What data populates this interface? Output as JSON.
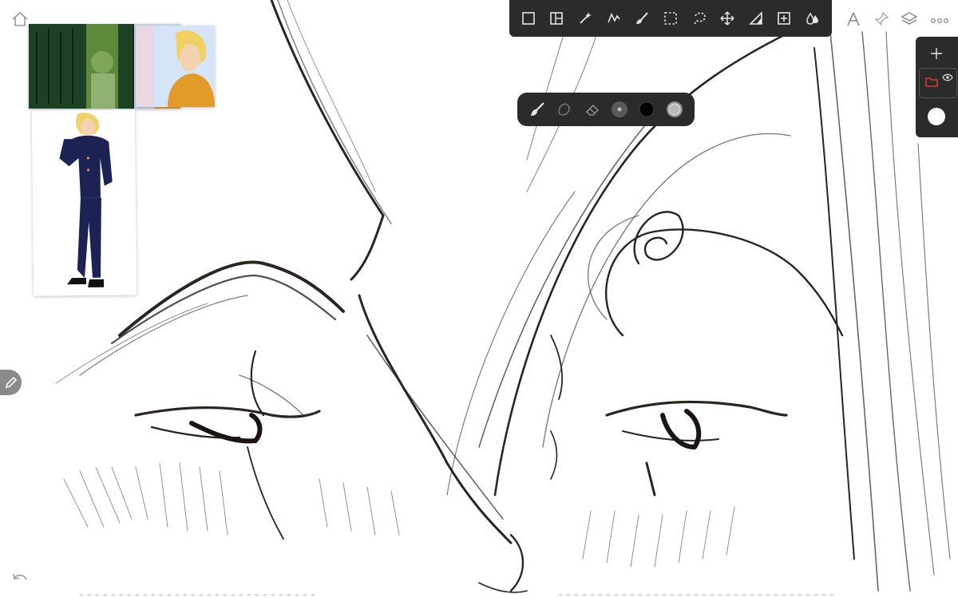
{
  "app": {
    "name": "Sketch canvas"
  },
  "colors": {
    "toolbar_bg": "#2b2b2b",
    "icon": "#e6e6e6",
    "stroke": "#2a2422",
    "accent_red": "#d93a3a"
  },
  "top_toolbar": {
    "tools": [
      {
        "name": "frame-icon"
      },
      {
        "name": "layout-icon"
      },
      {
        "name": "magic-wand-icon"
      },
      {
        "name": "stroke-adjust-icon"
      },
      {
        "name": "brush-tool-icon"
      },
      {
        "name": "rect-select-icon"
      },
      {
        "name": "lasso-select-icon"
      },
      {
        "name": "move-icon"
      },
      {
        "name": "gradient-icon"
      },
      {
        "name": "add-image-icon"
      },
      {
        "name": "color-drops-icon"
      }
    ]
  },
  "right_icons": [
    "ruler-icon",
    "pin-icon",
    "layers-icon",
    "more-icon"
  ],
  "brush_bar": {
    "items": [
      "paintbrush-icon",
      "smudge-icon",
      "eraser-icon",
      "brush-size-icon",
      "color-swatch-icon",
      "opacity-icon"
    ],
    "current_color": "#000000"
  },
  "layers_panel": {
    "items": [
      "add-layer-icon",
      "folder-layer-icon",
      "visibility-icon",
      "color-dot-icon"
    ]
  },
  "references": [
    "reference-image-scene",
    "reference-image-character"
  ]
}
